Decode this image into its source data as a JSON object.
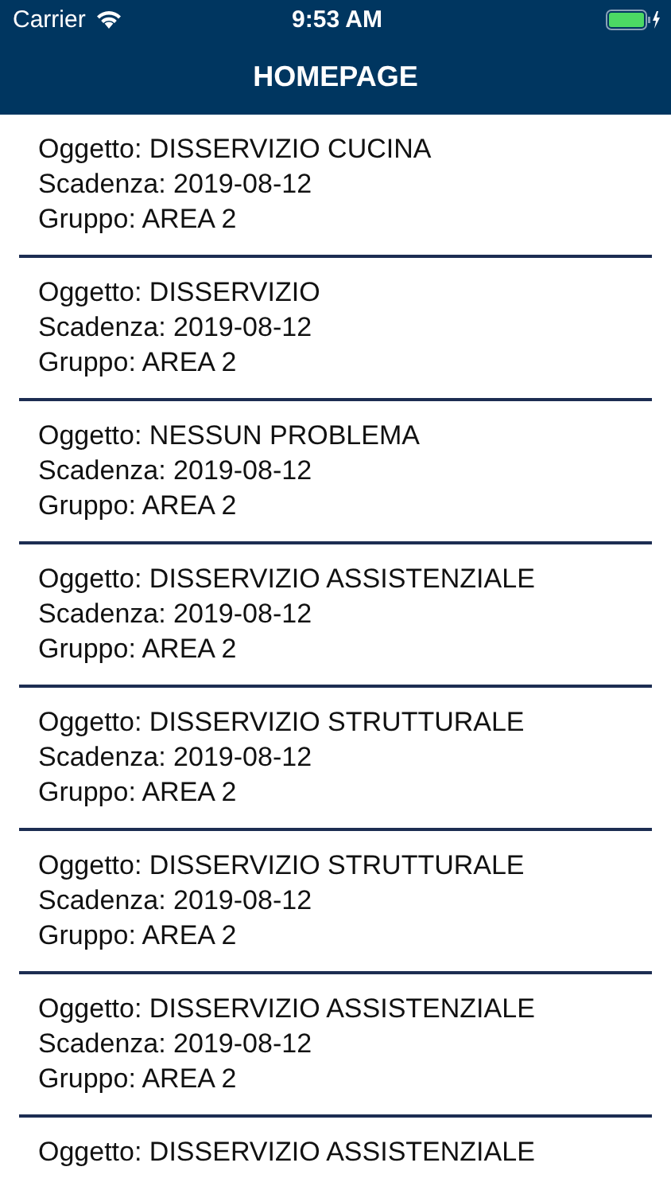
{
  "status_bar": {
    "carrier": "Carrier",
    "time": "9:53 AM"
  },
  "header": {
    "title": "HOMEPAGE"
  },
  "items": [
    {
      "oggetto": "Oggetto: DISSERVIZIO CUCINA",
      "scadenza": "Scadenza: 2019-08-12",
      "gruppo": "Gruppo: AREA 2"
    },
    {
      "oggetto": "Oggetto: DISSERVIZIO",
      "scadenza": "Scadenza: 2019-08-12",
      "gruppo": "Gruppo: AREA 2"
    },
    {
      "oggetto": "Oggetto: NESSUN PROBLEMA",
      "scadenza": "Scadenza: 2019-08-12",
      "gruppo": "Gruppo: AREA 2"
    },
    {
      "oggetto": "Oggetto: DISSERVIZIO ASSISTENZIALE",
      "scadenza": "Scadenza: 2019-08-12",
      "gruppo": "Gruppo: AREA 2"
    },
    {
      "oggetto": "Oggetto: DISSERVIZIO STRUTTURALE",
      "scadenza": "Scadenza: 2019-08-12",
      "gruppo": "Gruppo: AREA 2"
    },
    {
      "oggetto": "Oggetto: DISSERVIZIO STRUTTURALE",
      "scadenza": "Scadenza: 2019-08-12",
      "gruppo": "Gruppo: AREA 2"
    },
    {
      "oggetto": "Oggetto: DISSERVIZIO ASSISTENZIALE",
      "scadenza": "Scadenza: 2019-08-12",
      "gruppo": "Gruppo: AREA 2"
    },
    {
      "oggetto": "Oggetto: DISSERVIZIO ASSISTENZIALE"
    }
  ]
}
